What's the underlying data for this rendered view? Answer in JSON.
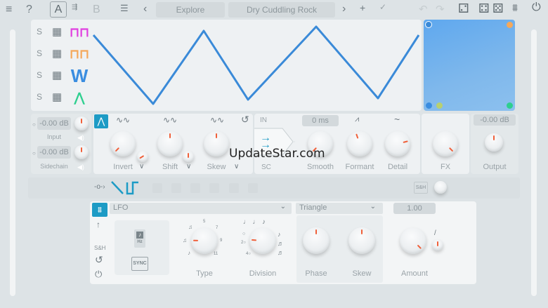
{
  "topbar": {
    "menu_icon": "≡",
    "help": "?",
    "preset_a": "A",
    "preset_b": "B",
    "prev": "‹",
    "next": "›",
    "category": "Explore",
    "preset_name": "Dry Cuddling Rock"
  },
  "lanes": [
    {
      "label": "S",
      "color": "#e040e0"
    },
    {
      "label": "S",
      "color": "#f5a85a"
    },
    {
      "label": "S",
      "color": "#3a8de0"
    },
    {
      "label": "S",
      "color": "#2ecf8f"
    }
  ],
  "wave_color": "#3a8ad8",
  "io": {
    "input_value": "-0.00 dB",
    "input_label": "Input",
    "sidechain_value": "-0.00 dB",
    "sidechain_label": "Sidechain"
  },
  "filter": {
    "invert": "Invert",
    "shift": "Shift",
    "skew": "Skew"
  },
  "route": {
    "in": "IN",
    "sc": "SC",
    "smooth_value": "0 ms",
    "smooth": "Smooth",
    "formant": "Formant",
    "detail": "Detail"
  },
  "fx": {
    "label": "FX"
  },
  "output": {
    "value": "-0.00 dB",
    "label": "Output"
  },
  "mod": {
    "sh": "S&H"
  },
  "lfo": {
    "source": "LFO",
    "sh": "S&H",
    "hz": "Hz",
    "sync": "SYNC",
    "type": "Type",
    "division": "Division",
    "type_ticks": [
      "5",
      "7",
      "9",
      "11"
    ],
    "division_ticks": [
      "2○",
      "4○"
    ],
    "shape": "Triangle",
    "phase": "Phase",
    "skew": "Skew",
    "amount_value": "1.00",
    "amount": "Amount"
  },
  "knobs": {
    "input": 0.5,
    "sidechain": 0.5,
    "invert": 0.0,
    "invert_mini": 0.05,
    "shift": 0.5,
    "shift_mini": 0.5,
    "skew": 0.5,
    "smooth": 0.0,
    "formant": 0.43,
    "detail": 0.78,
    "fx": 1.0,
    "output": 0.5,
    "type": 0.17,
    "division": 0.18,
    "phase": 0.5,
    "lfo_skew": 0.5,
    "amount": 1.0,
    "amount_mini": 0.5
  },
  "watermark": "UpdateStar.com"
}
